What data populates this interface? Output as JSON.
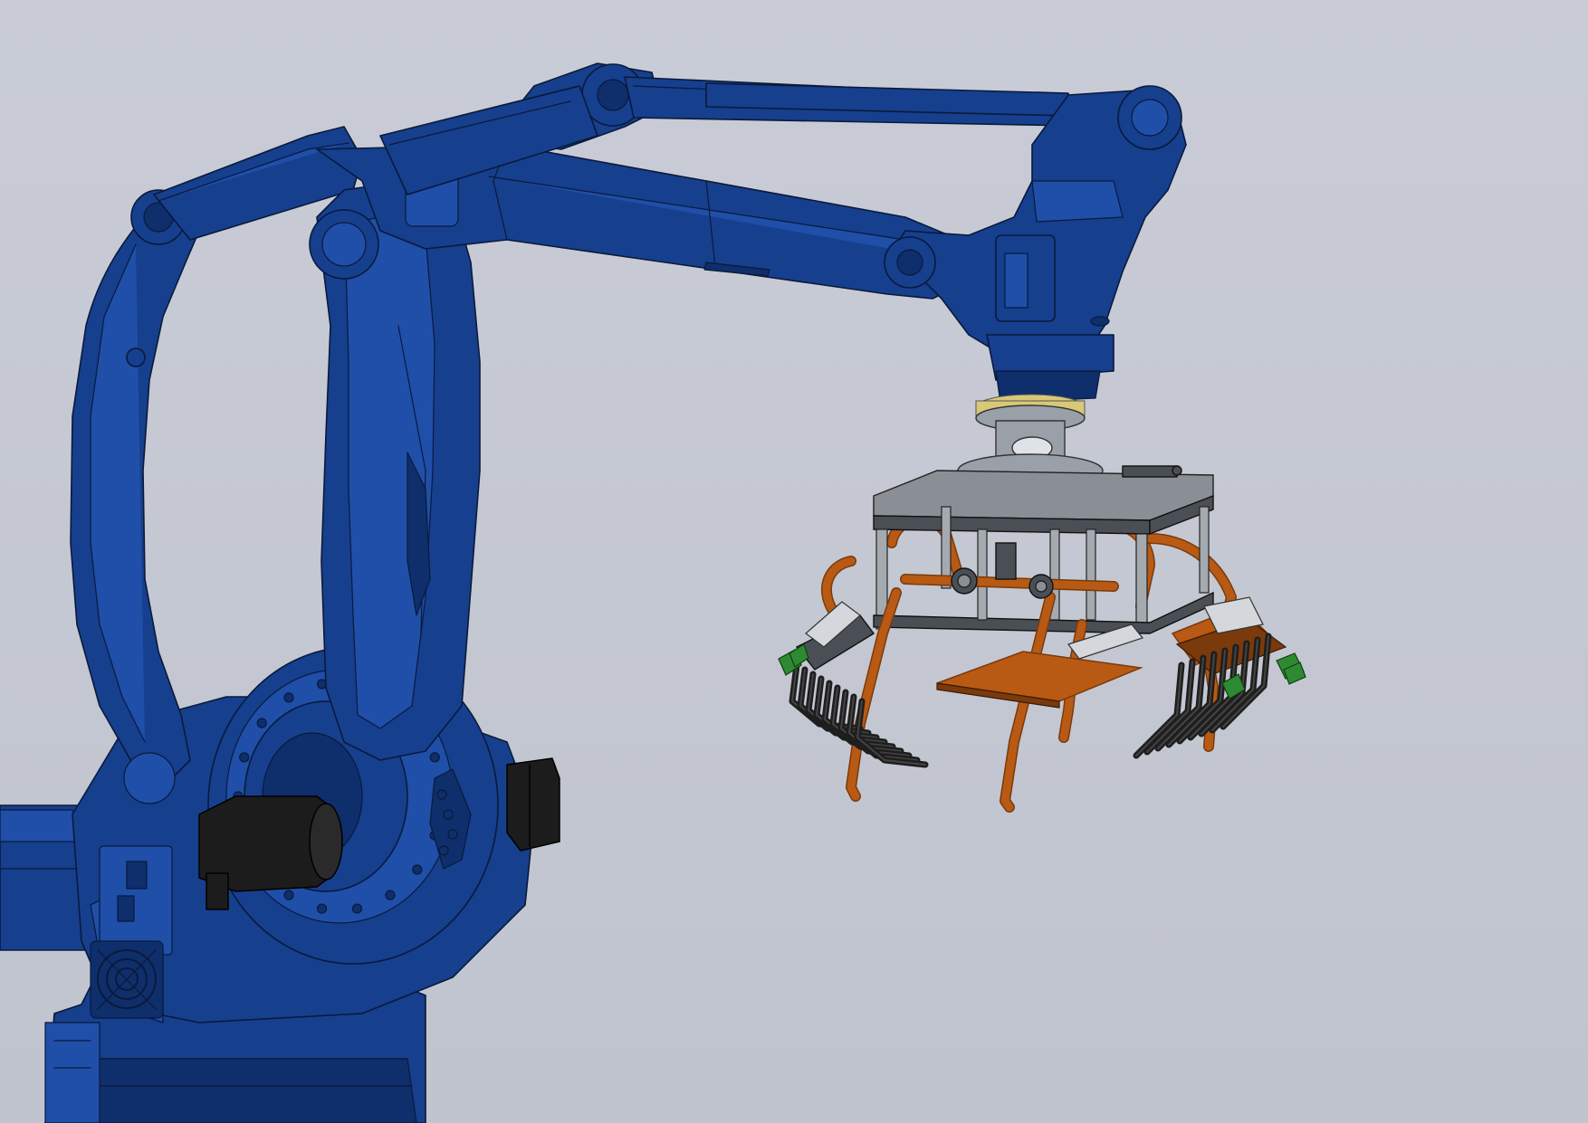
{
  "viewport": {
    "background_top": "#c9ccd6",
    "background_bottom": "#c0c4ce"
  },
  "colors": {
    "robot_body": "#163f8e",
    "robot_body_light": "#1f4fa8",
    "robot_body_dark": "#0f2e6c",
    "outline": "#0a1a3a",
    "motor": "#1c1c1c",
    "flange": "#9aa0a8",
    "flange_ring": "#d8c878",
    "frame_steel": "#8a8f96",
    "frame_dark": "#4a4f56",
    "orange_arm": "#b85a14",
    "orange_dark": "#7a3a0c",
    "tine_black": "#1e1e1e",
    "suction_green": "#2e8a32",
    "cylinder_silver": "#d4d8dc"
  },
  "components": [
    "robot-base",
    "lower-arm",
    "counterbalance-link",
    "upper-arm",
    "parallel-link-rod",
    "wrist-housing",
    "tool-flange",
    "gripper-frame",
    "gripper-fingers"
  ]
}
